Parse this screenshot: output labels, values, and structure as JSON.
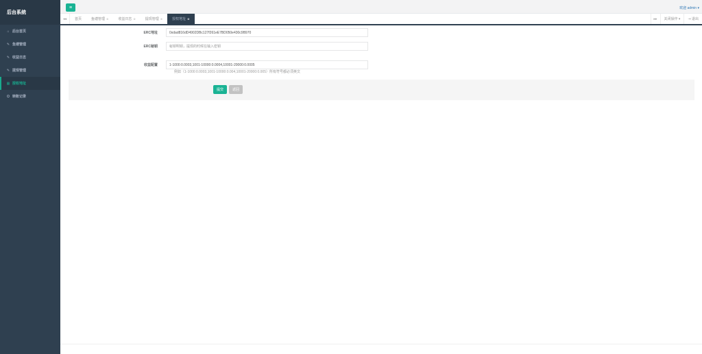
{
  "sidebar": {
    "title": "后台系统",
    "items": [
      {
        "icon": "home-icon",
        "glyph": "⌂",
        "label": "后台首页"
      },
      {
        "icon": "wrench-icon",
        "glyph": "✎",
        "label": "鱼塘管理"
      },
      {
        "icon": "wrench-icon",
        "glyph": "✎",
        "label": "收益日志"
      },
      {
        "icon": "wrench-icon",
        "glyph": "✎",
        "label": "提现管理"
      },
      {
        "icon": "grid-icon",
        "glyph": "▦",
        "label": "授权地址"
      },
      {
        "icon": "power-icon",
        "glyph": "⏻",
        "label": "转账记录"
      }
    ]
  },
  "topbar": {
    "toggle_glyph": "≡",
    "welcome": "欢迎 admin ▾"
  },
  "tabs": {
    "left_arrow": "◂◂",
    "right_arrow": "▸▸",
    "items": [
      {
        "label": "首页",
        "closable": false
      },
      {
        "label": "鱼塘管理",
        "closable": true
      },
      {
        "label": "收益日志",
        "closable": true
      },
      {
        "label": "提现管理",
        "closable": true
      },
      {
        "label": "授权地址",
        "closable": true
      }
    ],
    "close_glyph": "⊗",
    "close_ops": "关闭操作 ▾",
    "logout": "⇥ 退出"
  },
  "form": {
    "erc_address_label": "ERC地址",
    "erc_address_value": "0xdad816dD4902DBc127f261eE7BD050e430c9B970",
    "erc_key_label": "ERC秘钥",
    "erc_key_placeholder": "秘钥明钥，提现的时候在输入密钥",
    "income_label": "收益配置",
    "income_value": "1-1000:0.0003,1001-10000:0.0004,10001-20000:0.0005",
    "income_hint": "例如（1-1000:0.0003,1001-10000:0.004,10001-20000:0.005）所有符号都必须英文"
  },
  "actions": {
    "submit": "提交",
    "back": "返回"
  },
  "colors": {
    "sidebar_bg": "#2f4050",
    "accent": "#1ab394"
  }
}
